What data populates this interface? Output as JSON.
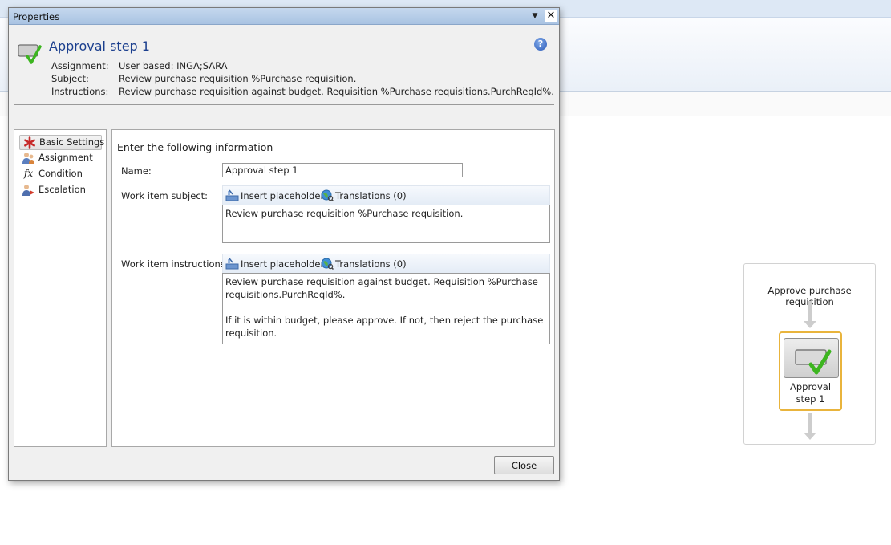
{
  "dialog": {
    "window_title": "Properties",
    "header_title": "Approval step 1",
    "meta": [
      {
        "label": "Assignment:",
        "value": "User based: INGA;SARA"
      },
      {
        "label": "Subject:",
        "value": "Review purchase requisition %Purchase requisition."
      },
      {
        "label": "Instructions:",
        "value": "Review purchase requisition against budget. Requisition %Purchase requisitions.PurchReqId%."
      }
    ],
    "close_label": "Close",
    "help_icon": "?",
    "close_glyph": "✕",
    "dropdown_glyph": "▼"
  },
  "nav": {
    "items": [
      {
        "label": "Basic Settings",
        "icon": "asterisk-icon"
      },
      {
        "label": "Assignment",
        "icon": "users-icon"
      },
      {
        "label": "Condition",
        "icon": "function-icon"
      },
      {
        "label": "Escalation",
        "icon": "escalation-icon"
      }
    ],
    "condition_glyph": "fx"
  },
  "form": {
    "section_title": "Enter the following information",
    "name_label": "Name:",
    "name_value": "Approval step 1",
    "subject_label": "Work item subject:",
    "instructions_label": "Work item instructions:",
    "insert_placeholder": "Insert placeholder",
    "translations": "Translations (0)",
    "subject_text": "Review purchase requisition %Purchase requisition.",
    "instructions_para1": "Review purchase requisition against budget. Requisition %Purchase requisitions.PurchReqId%.",
    "instructions_para2": "If it is within budget, please approve. If not, then reject the purchase requisition."
  },
  "workflow": {
    "title": "Approve purchase requisition",
    "step_label": "Approval step 1"
  },
  "colors": {
    "header_title": "#1b3f8e",
    "step_border": "#e9b43c",
    "check_green": "#3cb51f"
  }
}
